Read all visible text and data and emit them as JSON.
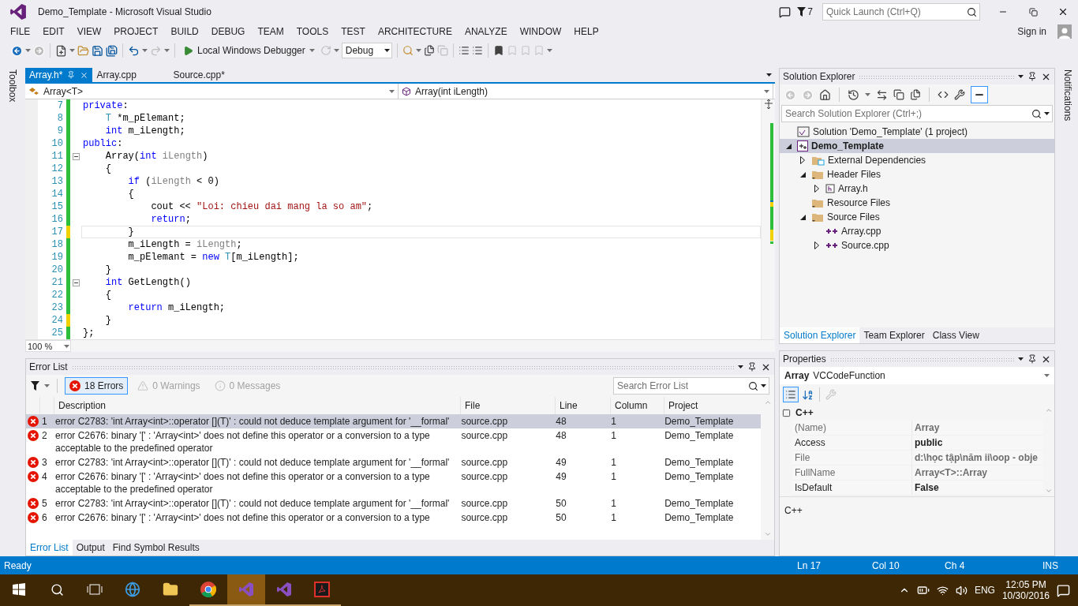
{
  "window": {
    "title": "Demo_Template - Microsoft Visual Studio",
    "notification_count": "7",
    "quick_launch": {
      "placeholder": "Quick Launch (Ctrl+Q)"
    }
  },
  "menu": [
    "FILE",
    "EDIT",
    "VIEW",
    "PROJECT",
    "BUILD",
    "DEBUG",
    "TEAM",
    "TOOLS",
    "TEST",
    "ARCHITECTURE",
    "ANALYZE",
    "WINDOW",
    "HELP"
  ],
  "sign_in": "Sign in",
  "toolbar": {
    "debugger": "Local Windows Debugger",
    "configuration": "Debug"
  },
  "side_tabs": {
    "left": "Toolbox",
    "right": "Notifications"
  },
  "editor": {
    "tabs": [
      {
        "label": "Array.h*",
        "selected": true
      },
      {
        "label": "Array.cpp",
        "selected": false
      },
      {
        "label": "Source.cpp*",
        "selected": false
      }
    ],
    "scope": "Array<T>",
    "member": "Array(int iLength)",
    "zoom": "100 %",
    "lines": [
      {
        "number": "7",
        "modified": false,
        "current": false,
        "fold": false,
        "tokens": [
          {
            "kind": "keyword",
            "text": "private"
          },
          {
            "kind": "plain",
            "text": ":"
          }
        ]
      },
      {
        "number": "8",
        "modified": false,
        "current": false,
        "fold": false,
        "tokens": [
          {
            "kind": "type",
            "text": "    T"
          },
          {
            "kind": "plain",
            "text": " *m_pElemant;"
          }
        ]
      },
      {
        "number": "9",
        "modified": false,
        "current": false,
        "fold": false,
        "tokens": [
          {
            "kind": "keyword",
            "text": "    int"
          },
          {
            "kind": "plain",
            "text": " m_iLength;"
          }
        ]
      },
      {
        "number": "10",
        "modified": false,
        "current": false,
        "fold": false,
        "tokens": [
          {
            "kind": "keyword",
            "text": "public"
          },
          {
            "kind": "plain",
            "text": ":"
          }
        ]
      },
      {
        "number": "11",
        "modified": false,
        "current": false,
        "fold": true,
        "tokens": [
          {
            "kind": "plain",
            "text": "    Array("
          },
          {
            "kind": "keyword",
            "text": "int"
          },
          {
            "kind": "param",
            "text": " iLength"
          },
          {
            "kind": "plain",
            "text": ")"
          }
        ]
      },
      {
        "number": "12",
        "modified": false,
        "current": false,
        "fold": false,
        "tokens": [
          {
            "kind": "plain",
            "text": "    {"
          }
        ]
      },
      {
        "number": "13",
        "modified": false,
        "current": false,
        "fold": false,
        "tokens": [
          {
            "kind": "keyword",
            "text": "        if"
          },
          {
            "kind": "plain",
            "text": " ("
          },
          {
            "kind": "param",
            "text": "iLength"
          },
          {
            "kind": "plain",
            "text": " < 0)"
          }
        ]
      },
      {
        "number": "14",
        "modified": false,
        "current": false,
        "fold": false,
        "tokens": [
          {
            "kind": "plain",
            "text": "        {"
          }
        ]
      },
      {
        "number": "15",
        "modified": false,
        "current": false,
        "fold": false,
        "tokens": [
          {
            "kind": "plain",
            "text": "            cout << "
          },
          {
            "kind": "string",
            "text": "\"Loi: chieu dai mang la so am\""
          },
          {
            "kind": "plain",
            "text": ";"
          }
        ]
      },
      {
        "number": "16",
        "modified": false,
        "current": false,
        "fold": false,
        "tokens": [
          {
            "kind": "keyword",
            "text": "            return"
          },
          {
            "kind": "plain",
            "text": ";"
          }
        ]
      },
      {
        "number": "17",
        "modified": true,
        "current": true,
        "fold": false,
        "tokens": [
          {
            "kind": "plain",
            "text": "        }"
          }
        ]
      },
      {
        "number": "18",
        "modified": false,
        "current": false,
        "fold": false,
        "tokens": [
          {
            "kind": "plain",
            "text": "        m_iLength = "
          },
          {
            "kind": "param",
            "text": "iLength"
          },
          {
            "kind": "plain",
            "text": ";"
          }
        ]
      },
      {
        "number": "19",
        "modified": false,
        "current": false,
        "fold": false,
        "tokens": [
          {
            "kind": "plain",
            "text": "        m_pElemant = "
          },
          {
            "kind": "keyword",
            "text": "new"
          },
          {
            "kind": "type",
            "text": " T"
          },
          {
            "kind": "plain",
            "text": "[m_iLength];"
          }
        ]
      },
      {
        "number": "20",
        "modified": false,
        "current": false,
        "fold": false,
        "tokens": [
          {
            "kind": "plain",
            "text": "    }"
          }
        ]
      },
      {
        "number": "21",
        "modified": false,
        "current": false,
        "fold": true,
        "tokens": [
          {
            "kind": "keyword",
            "text": "    int"
          },
          {
            "kind": "plain",
            "text": " GetLength()"
          }
        ]
      },
      {
        "number": "22",
        "modified": false,
        "current": false,
        "fold": false,
        "tokens": [
          {
            "kind": "plain",
            "text": "    {"
          }
        ]
      },
      {
        "number": "23",
        "modified": false,
        "current": false,
        "fold": false,
        "tokens": [
          {
            "kind": "keyword",
            "text": "        return"
          },
          {
            "kind": "plain",
            "text": " m_iLength;"
          }
        ]
      },
      {
        "number": "24",
        "modified": true,
        "current": false,
        "fold": false,
        "tokens": [
          {
            "kind": "plain",
            "text": "    }"
          }
        ]
      },
      {
        "number": "25",
        "modified": false,
        "current": false,
        "fold": false,
        "tokens": [
          {
            "kind": "plain",
            "text": "};"
          }
        ]
      }
    ]
  },
  "error_list": {
    "title": "Error List",
    "filters": [
      {
        "kind": "error",
        "label": "18 Errors",
        "selected": true
      },
      {
        "kind": "warning",
        "label": "0 Warnings",
        "selected": false
      },
      {
        "kind": "message",
        "label": "0 Messages",
        "selected": false
      }
    ],
    "search": {
      "placeholder": "Search Error List"
    },
    "columns": [
      "Description",
      "File",
      "Line",
      "Column",
      "Project"
    ],
    "rows": [
      {
        "number": "1",
        "description": "error C2783: 'int Array<int>::operator [](T)' : could not deduce template argument for '__formal'",
        "file": "source.cpp",
        "line": "48",
        "column": "1",
        "project": "Demo_Template",
        "selected": true
      },
      {
        "number": "2",
        "description": "error C2676: binary '[' : 'Array<int>' does not define this operator or a conversion to a type acceptable to the predefined operator",
        "file": "source.cpp",
        "line": "48",
        "column": "1",
        "project": "Demo_Template",
        "selected": false
      },
      {
        "number": "3",
        "description": "error C2783: 'int Array<int>::operator [](T)' : could not deduce template argument for '__formal'",
        "file": "source.cpp",
        "line": "49",
        "column": "1",
        "project": "Demo_Template",
        "selected": false
      },
      {
        "number": "4",
        "description": "error C2676: binary '[' : 'Array<int>' does not define this operator or a conversion to a type acceptable to the predefined operator",
        "file": "source.cpp",
        "line": "49",
        "column": "1",
        "project": "Demo_Template",
        "selected": false
      },
      {
        "number": "5",
        "description": "error C2783: 'int Array<int>::operator [](T)' : could not deduce template argument for '__formal'",
        "file": "source.cpp",
        "line": "50",
        "column": "1",
        "project": "Demo_Template",
        "selected": false
      },
      {
        "number": "6",
        "description": "error C2676: binary '[' : 'Array<int>' does not define this operator or a conversion to a type",
        "file": "source.cpp",
        "line": "50",
        "column": "1",
        "project": "Demo_Template",
        "selected": false
      }
    ],
    "tabs": [
      {
        "label": "Error List",
        "selected": true
      },
      {
        "label": "Output",
        "selected": false
      },
      {
        "label": "Find Symbol Results",
        "selected": false
      }
    ]
  },
  "solution_explorer": {
    "title": "Solution Explorer",
    "search": {
      "placeholder": "Search Solution Explorer (Ctrl+;)"
    },
    "tree": [
      {
        "label": "Solution 'Demo_Template' (1 project)",
        "kind": "solution",
        "expandable": false,
        "expanded": true,
        "selected": false,
        "children": [
          {
            "label": "Demo_Template",
            "kind": "project",
            "expandable": true,
            "expanded": true,
            "selected": true,
            "children": [
              {
                "label": "External Dependencies",
                "kind": "references",
                "expandable": true,
                "expanded": false,
                "selected": false
              },
              {
                "label": "Header Files",
                "kind": "filter",
                "expandable": true,
                "expanded": true,
                "selected": false,
                "children": [
                  {
                    "label": "Array.h",
                    "kind": "header",
                    "expandable": true,
                    "expanded": false,
                    "selected": false
                  }
                ]
              },
              {
                "label": "Resource Files",
                "kind": "filter",
                "expandable": false,
                "selected": false
              },
              {
                "label": "Source Files",
                "kind": "filter",
                "expandable": true,
                "expanded": true,
                "selected": false,
                "children": [
                  {
                    "label": "Array.cpp",
                    "kind": "source",
                    "expandable": false,
                    "selected": false
                  },
                  {
                    "label": "Source.cpp",
                    "kind": "source",
                    "expandable": true,
                    "expanded": false,
                    "selected": false
                  }
                ]
              }
            ]
          }
        ]
      }
    ],
    "tabs": [
      {
        "label": "Solution Explorer",
        "selected": true
      },
      {
        "label": "Team Explorer",
        "selected": false
      },
      {
        "label": "Class View",
        "selected": false
      }
    ]
  },
  "properties": {
    "title": "Properties",
    "object_name": "Array",
    "object_type": "VCCodeFunction",
    "category": "C++",
    "rows": [
      {
        "name": "(Name)",
        "value": "Array",
        "readonly": true
      },
      {
        "name": "Access",
        "value": "public",
        "readonly": false
      },
      {
        "name": "File",
        "value": "d:\\học tập\\năm ii\\oop - obje",
        "readonly": true
      },
      {
        "name": "FullName",
        "value": "Array<T>::Array",
        "readonly": true
      },
      {
        "name": "IsDefault",
        "value": "False",
        "readonly": false
      }
    ],
    "description": "C++"
  },
  "status_bar": {
    "message": "Ready",
    "line": "Ln 17",
    "column": "Col 10",
    "char": "Ch 4",
    "mode": "INS"
  },
  "taskbar": {
    "apps": [
      {
        "kind": "start",
        "selected": false,
        "running": false
      },
      {
        "kind": "search",
        "selected": false,
        "running": false
      },
      {
        "kind": "task-view",
        "selected": false,
        "running": false
      },
      {
        "kind": "browser",
        "selected": false,
        "running": false
      },
      {
        "kind": "folder",
        "selected": false,
        "running": false
      },
      {
        "kind": "wheel",
        "selected": false,
        "running": true
      },
      {
        "kind": "ide",
        "selected": true,
        "running": true
      },
      {
        "kind": "ide",
        "selected": false,
        "running": true
      },
      {
        "kind": "pdf",
        "selected": false,
        "running": true
      }
    ],
    "language": "ENG",
    "time": "12:05 PM",
    "date": "10/30/2016"
  }
}
